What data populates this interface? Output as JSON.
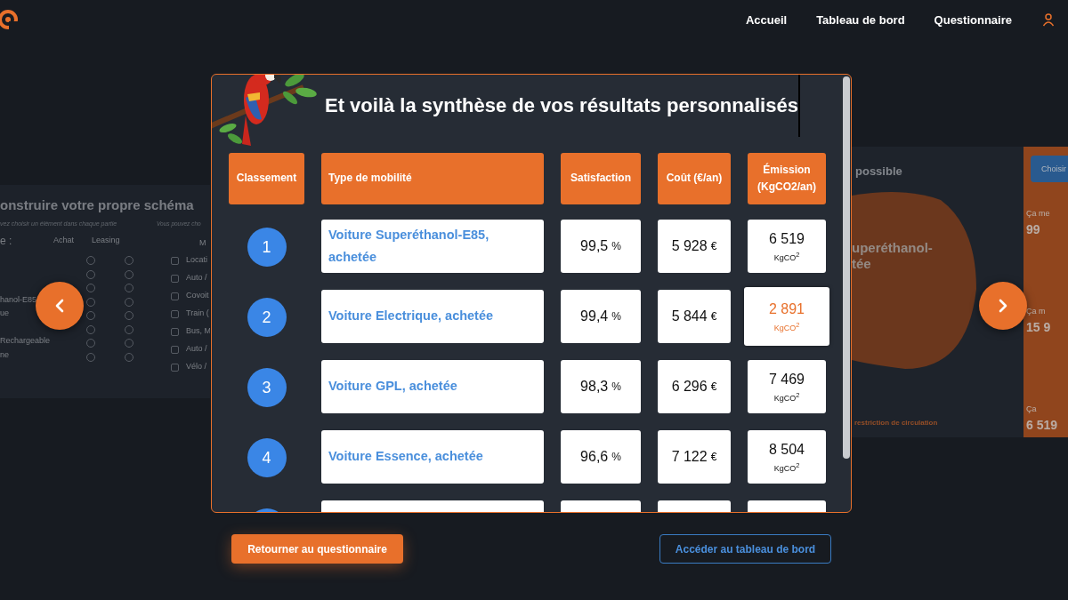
{
  "nav": {
    "links": [
      {
        "label": "Accueil"
      },
      {
        "label": "Tableau de bord"
      },
      {
        "label": "Questionnaire"
      }
    ]
  },
  "background_left": {
    "title": "onstruire votre propre schéma",
    "hint_1": "vez choisir un élément dans chaque partie",
    "hint_2": "Vous pouvez cho",
    "section": "e :",
    "columns": [
      "Achat",
      "Leasing"
    ],
    "column_3": "M",
    "options": [
      {
        "achat": false,
        "leasing": false
      },
      {
        "achat": false,
        "leasing": false
      },
      {
        "achat": false,
        "leasing": false
      },
      {
        "label": "hanol-E85",
        "achat": false,
        "leasing": false
      },
      {
        "label": "ue",
        "achat": false,
        "leasing": false
      },
      {
        "achat": false,
        "leasing": false
      },
      {
        "label": "Rechargeable",
        "achat": false,
        "leasing": false
      },
      {
        "label": "ne",
        "achat": false,
        "leasing": false
      }
    ],
    "checkboxes": [
      {
        "label": "Locati",
        "checked": false
      },
      {
        "label": "Auto /",
        "checked": false
      },
      {
        "label": "Covoit",
        "checked": false
      },
      {
        "label": "Train (",
        "checked": false
      },
      {
        "label": "Bus, M",
        "checked": false
      },
      {
        "label": "Auto /",
        "checked": false
      },
      {
        "label": "Vélo /",
        "checked": false
      }
    ]
  },
  "background_right": {
    "title": "possible",
    "vehicle_lines": [
      "uperéthanol-",
      "tée"
    ],
    "footer": "restriction de circulation",
    "button": "Choisir",
    "stats": [
      {
        "label": "Ça me",
        "value": "99"
      },
      {
        "label": "Ça m",
        "value": "15 9"
      },
      {
        "label": "Ça",
        "value": "6 519"
      }
    ]
  },
  "modal": {
    "title": "Et voilà la synthèse de vos résultats personnalisés",
    "columns": [
      "Classement",
      "Type de mobilité",
      "Satisfaction",
      "Coût (€/an)",
      "Émission (KgCO2/an)"
    ],
    "rows": [
      {
        "rank": "1",
        "mobility": "Voiture Superéthanol-E85, achetée",
        "satisfaction": "99,5",
        "satisfaction_unit": "%",
        "cost": "5 928",
        "cost_unit": "€",
        "emission": "6 519",
        "emission_unit": "KgCO$^{2}$",
        "highlighted": false
      },
      {
        "rank": "2",
        "mobility": "Voiture Electrique, achetée",
        "satisfaction": "99,4",
        "satisfaction_unit": "%",
        "cost": "5 844",
        "cost_unit": "€",
        "emission": "2 891",
        "emission_unit": "KgCO$^{2}$",
        "highlighted": true
      },
      {
        "rank": "3",
        "mobility": "Voiture GPL, achetée",
        "satisfaction": "98,3",
        "satisfaction_unit": "%",
        "cost": "6 296",
        "cost_unit": "€",
        "emission": "7 469",
        "emission_unit": "KgCO$^{2}$",
        "highlighted": false
      },
      {
        "rank": "4",
        "mobility": "Voiture Essence, achetée",
        "satisfaction": "96,6",
        "satisfaction_unit": "%",
        "cost": "7 122",
        "cost_unit": "€",
        "emission": "8 504",
        "emission_unit": "KgCO$^{2}$",
        "highlighted": false
      }
    ]
  },
  "actions": {
    "back": "Retourner au questionnaire",
    "dashboard": "Accéder au tableau de bord"
  }
}
